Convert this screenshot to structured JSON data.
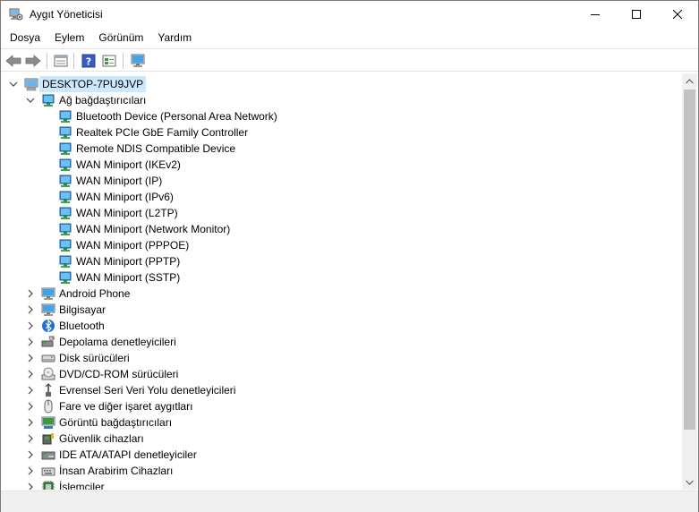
{
  "window": {
    "title": "Aygıt Yöneticisi",
    "icon": "device-manager-icon"
  },
  "menu": {
    "items": [
      "Dosya",
      "Eylem",
      "Görünüm",
      "Yardım"
    ]
  },
  "toolbar": {
    "buttons": [
      "back-arrow-icon",
      "forward-arrow-icon",
      "properties-icon",
      "help-icon",
      "view-icon",
      "scan-hardware-icon"
    ]
  },
  "tree": {
    "root": "DESKTOP-7PU9JVP",
    "expanded_category": "Ağ bağdaştırıcıları",
    "network_adapters": [
      "Bluetooth Device (Personal Area Network)",
      "Realtek PCIe GbE Family Controller",
      "Remote NDIS Compatible Device",
      "WAN Miniport (IKEv2)",
      "WAN Miniport (IP)",
      "WAN Miniport (IPv6)",
      "WAN Miniport (L2TP)",
      "WAN Miniport (Network Monitor)",
      "WAN Miniport (PPPOE)",
      "WAN Miniport (PPTP)",
      "WAN Miniport (SSTP)"
    ],
    "categories": [
      {
        "label": "Android Phone",
        "icon": "monitor-icon"
      },
      {
        "label": "Bilgisayar",
        "icon": "computer-icon"
      },
      {
        "label": "Bluetooth",
        "icon": "bluetooth-icon"
      },
      {
        "label": "Depolama denetleyicileri",
        "icon": "storage-controller-icon"
      },
      {
        "label": "Disk sürücüleri",
        "icon": "disk-drive-icon"
      },
      {
        "label": "DVD/CD-ROM sürücüleri",
        "icon": "dvd-drive-icon"
      },
      {
        "label": "Evrensel Seri Veri Yolu denetleyicileri",
        "icon": "usb-icon"
      },
      {
        "label": "Fare ve diğer işaret aygıtları",
        "icon": "mouse-icon"
      },
      {
        "label": "Görüntü bağdaştırıcıları",
        "icon": "display-adapter-icon"
      },
      {
        "label": "Güvenlik cihazları",
        "icon": "security-device-icon"
      },
      {
        "label": "IDE ATA/ATAPI denetleyiciler",
        "icon": "ide-controller-icon"
      },
      {
        "label": "İnsan Arabirim Cihazları",
        "icon": "hid-icon"
      },
      {
        "label": "İşlemciler",
        "icon": "processor-icon"
      }
    ]
  },
  "colors": {
    "selection": "#cce8ff",
    "network_icon": "#2f8fd8",
    "scrollbar_thumb": "#c2c2c2"
  }
}
